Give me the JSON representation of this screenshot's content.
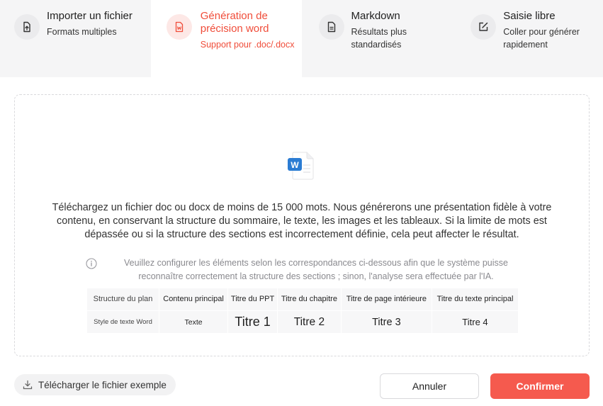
{
  "tabs": [
    {
      "title": "Importer un fichier",
      "subtitle": "Formats multiples",
      "icon": "upload-file-icon"
    },
    {
      "title": "Génération de précision word",
      "subtitle": "Support pour .doc/.docx",
      "icon": "word-file-icon",
      "active": true
    },
    {
      "title": "Markdown",
      "subtitle": "Résultats plus standardisés",
      "icon": "document-lines-icon"
    },
    {
      "title": "Saisie libre",
      "subtitle": "Coller pour générer rapidement",
      "icon": "edit-icon"
    }
  ],
  "upload": {
    "description": "Téléchargez un fichier doc ou docx de moins de 15 000 mots. Nous générerons une présentation fidèle à votre contenu, en conservant la structure du sommaire, le texte, les images et les tableaux. Si la limite de mots est dépassée ou si la structure des sections est incorrectement définie, cela peut affecter le résultat.",
    "note": "Veuillez configurer les éléments selon les correspondances ci-dessous afin que le système puisse reconnaître correctement la structure des sections ; sinon, l'analyse sera effectuée par l'IA.",
    "word_badge": "W"
  },
  "mapping": {
    "row1_header": "Structure du plan",
    "row2_header": "Style de texte Word",
    "plan": [
      "Contenu principal",
      "Titre du PPT",
      "Titre du chapitre",
      "Titre de page intérieure",
      "Titre du texte principal"
    ],
    "styles": [
      "Texte",
      "Titre 1",
      "Titre 2",
      "Titre 3",
      "Titre 4"
    ]
  },
  "footer": {
    "sample_label": "Télécharger le fichier exemple",
    "cancel_label": "Annuler",
    "confirm_label": "Confirmer"
  },
  "colors": {
    "accent": "#f04d3a",
    "confirm": "#f55a4e",
    "word_blue": "#2b7cd3"
  }
}
